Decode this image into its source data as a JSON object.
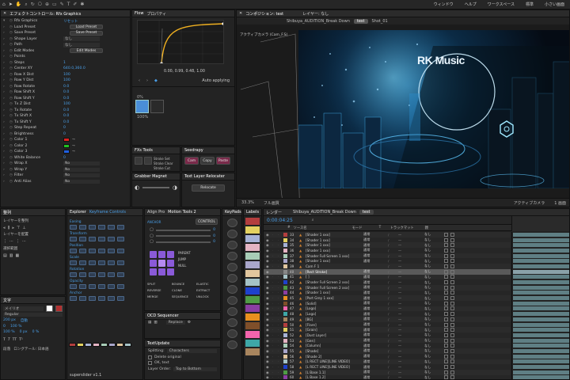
{
  "menubar": {
    "items": [
      "ウィンドウ",
      "ヘルプ",
      "ワークスペース",
      "標準",
      "小さい画面"
    ]
  },
  "left_panel": {
    "title": "エフェクトコントロール: Rfx Graphics",
    "rows": [
      {
        "label": "Rfx Graphics",
        "value": "リセット"
      },
      {
        "label": "Load Preset",
        "value": "Load Preset"
      },
      {
        "label": "Save Preset",
        "value": "Save Preset"
      },
      {
        "label": "Shape Layer",
        "value": "なし"
      },
      {
        "label": "Path",
        "value": "なし"
      },
      {
        "label": "Edit Modes",
        "value": "Edit Modes"
      },
      {
        "label": "Points",
        "value": ""
      },
      {
        "label": "Steps",
        "value": "1"
      },
      {
        "label": "Center XY",
        "value": "640.0,360.0"
      },
      {
        "label": "Row X Dist",
        "value": "100"
      },
      {
        "label": "Row Y Dist",
        "value": "100"
      },
      {
        "label": "Row Rotate",
        "value": "0.0"
      },
      {
        "label": "Row Shift X",
        "value": "0.0"
      },
      {
        "label": "Row Shift Y",
        "value": "0.0"
      },
      {
        "label": "Tx Z Dist",
        "value": "100"
      },
      {
        "label": "Tx Rotate",
        "value": "0.0"
      },
      {
        "label": "Tx Shift X",
        "value": "0.0"
      },
      {
        "label": "Tx Shift Y",
        "value": "0.0"
      },
      {
        "label": "Step Repeat",
        "value": "0"
      },
      {
        "label": "Brightness",
        "value": "0"
      },
      {
        "label": "Color 1",
        "value": ""
      },
      {
        "label": "Color 2",
        "value": ""
      },
      {
        "label": "Color 3",
        "value": ""
      },
      {
        "label": "White Balance",
        "value": "0"
      },
      {
        "label": "Wrap X",
        "value": "No"
      },
      {
        "label": "Wrap Y",
        "value": "No"
      },
      {
        "label": "Filter",
        "value": "No"
      },
      {
        "label": "Anti Alias",
        "value": "No"
      }
    ],
    "colors": [
      "#e02020",
      "#20c020",
      "#2060e0"
    ]
  },
  "flow": {
    "tabs": [
      "Flow",
      "プロパティ"
    ],
    "readout": "0.00, 0.99, 0.48, 1.00",
    "mode": "Auto applying",
    "label_in": "0%",
    "label_out": "100%"
  },
  "comp_view": {
    "tabs": [
      "コンポジション: test",
      "レイヤー: なし"
    ],
    "subtabs": [
      "Shibuya_AUDITION_Break Down",
      "test",
      "Shot_01"
    ],
    "left_label": "アクティブカメラ (Cam_F.S)",
    "watermark": "RK Music",
    "status": [
      "33.3%",
      "フル画質",
      "アクティブカメラ",
      "1 画面"
    ]
  },
  "fx_tools": {
    "title": "FXs Tools",
    "labels": [
      "Stroke Set",
      "Stroke Clear",
      "Stroke Cut"
    ]
  },
  "seedrapy": {
    "title": "Seedrapy",
    "labels": [
      "Cam",
      "Copy",
      "Paste"
    ]
  },
  "grabber": {
    "title": "Grabber Magnet",
    "labels": [
      "tmp",
      "Shot",
      "Anchor"
    ]
  },
  "text_layer": {
    "title": "Text Layer Relocater",
    "button": "Relocate"
  },
  "align_panel": {
    "title": "整列",
    "labels": [
      "レイヤーを整列",
      "レイヤーを配置",
      "選択範囲",
      "配置: 選択範囲"
    ]
  },
  "typo_panel": {
    "labels": [
      "文字",
      "メイリオ",
      "Regular",
      "200 px",
      "自動",
      "0",
      "100 %",
      "100 %",
      "0 px",
      "0 %"
    ],
    "bottom": [
      "段落",
      "ロングテール: 日本語"
    ]
  },
  "explorer": {
    "title": "Keyframe",
    "tabs": [
      "Explorer",
      "Keyframe Controls"
    ],
    "sections": [
      "Easing",
      "Transform",
      "Position",
      "Scale",
      "Rotation",
      "Opacity",
      "Anchor"
    ],
    "footer": "superslider v1.1"
  },
  "motion_tools": {
    "tabs": [
      "Align Pro",
      "Motion Tools 2"
    ],
    "buttons": [
      "ANCHOR",
      "CONTROL",
      "PARENT",
      "JUMP",
      "NULL",
      "SPLIT",
      "BOUNCE",
      "ELASTIC",
      "REVERSE",
      "CLONE",
      "EXTRACT",
      "MERGE",
      "SEQUENCE",
      "UNLOCK"
    ],
    "readout": [
      "0",
      "0",
      "0"
    ]
  },
  "ocd_panel": {
    "title": "OCD Sequencer",
    "value": "Replace"
  },
  "textupdate": {
    "title": "TextUpdate",
    "splitting": "Characters",
    "options": [
      "Delete original",
      "OK, text"
    ],
    "layer_order": "Top to Bottom"
  },
  "keypads": {
    "title": "KeyPads"
  },
  "labels_panel": {
    "title": "Labels",
    "colors": [
      "#b33e3e",
      "#e3d160",
      "#a6b2d6",
      "#e4b4c3",
      "#a8cdb7",
      "#a9a6cb",
      "#e1c69e",
      "#a5c2c6",
      "#1e41cc",
      "#4f9b45",
      "#8b3ea2",
      "#e8901e",
      "#7f4f2a",
      "#f464ad",
      "#3ea7a7",
      "#a8855e"
    ]
  },
  "timeline": {
    "tabs": [
      "レンダー",
      "Shibuya_AUDITION_Break Down",
      "test"
    ],
    "timecode": "0:00:04:25",
    "columns": [
      "#",
      "ソース名",
      "モード",
      "T",
      "トラックマット",
      "親"
    ],
    "layers": [
      {
        "num": "33",
        "name": "[Shader 1 xxx]",
        "mode": "通常",
        "parent": "なし",
        "color": "#b33e3e"
      },
      {
        "num": "34",
        "name": "[Shader 1 xxx]",
        "mode": "通常",
        "parent": "なし",
        "color": "#e3d160"
      },
      {
        "num": "35",
        "name": "[Shader 1 xxx]",
        "mode": "通常",
        "parent": "なし",
        "color": "#a6b2d6"
      },
      {
        "num": "36",
        "name": "[Shader 1 xxx]",
        "mode": "通常",
        "parent": "なし",
        "color": "#e4b4c3"
      },
      {
        "num": "37",
        "name": "[Shader Full Screen 1 xxx]",
        "mode": "通常",
        "parent": "なし",
        "color": "#a8cdb7"
      },
      {
        "num": "38",
        "name": "[Shader 1 xxx]",
        "mode": "通常",
        "parent": "なし",
        "color": "#a9a6cb"
      },
      {
        "num": "39",
        "name": "Cam F 1",
        "mode": "",
        "parent": "なし",
        "color": "#e1c69e"
      },
      {
        "num": "40",
        "name": "[Rect Stroke]",
        "mode": "通常",
        "parent": "なし",
        "color": "#888888"
      },
      {
        "num": "41",
        "name": "[ ]",
        "mode": "通常",
        "parent": "なし",
        "color": "#a5c2c6"
      },
      {
        "num": "42",
        "name": "[Shader Full Screen 2 xxx]",
        "mode": "通常",
        "parent": "なし",
        "color": "#1e41cc"
      },
      {
        "num": "43",
        "name": "[Shader Full Screen 2 xxx]",
        "mode": "通常",
        "parent": "なし",
        "color": "#4f9b45"
      },
      {
        "num": "44",
        "name": "[Shader 1 xxx]",
        "mode": "通常",
        "parent": "なし",
        "color": "#8b3ea2"
      },
      {
        "num": "45",
        "name": "[Part Grey 1 xxx]",
        "mode": "通常",
        "parent": "なし",
        "color": "#e8901e"
      },
      {
        "num": "46",
        "name": "[Solid]",
        "mode": "通常",
        "parent": "なし",
        "color": "#7f4f2a"
      },
      {
        "num": "47",
        "name": "[Logo]",
        "mode": "通常",
        "parent": "なし",
        "color": "#f464ad"
      },
      {
        "num": "48",
        "name": "[Logo]",
        "mode": "通常",
        "parent": "なし",
        "color": "#3ea7a7"
      },
      {
        "num": "49",
        "name": "[BG]",
        "mode": "通常",
        "parent": "なし",
        "color": "#a8855e"
      },
      {
        "num": "50",
        "name": "[Flare]",
        "mode": "通常",
        "parent": "なし",
        "color": "#b33e3e"
      },
      {
        "num": "51",
        "name": "[Grain]",
        "mode": "通常",
        "parent": "なし",
        "color": "#e3d160"
      },
      {
        "num": "52",
        "name": "[Dust Layer]",
        "mode": "通常",
        "parent": "なし",
        "color": "#a6b2d6"
      },
      {
        "num": "53",
        "name": "[Gen]",
        "mode": "通常",
        "parent": "なし",
        "color": "#e4b4c3"
      },
      {
        "num": "54",
        "name": "[Column]",
        "mode": "通常",
        "parent": "なし",
        "color": "#a8cdb7"
      },
      {
        "num": "55",
        "name": "[Shade]",
        "mode": "通常",
        "parent": "なし",
        "color": "#a9a6cb"
      },
      {
        "num": "56",
        "name": "[Shade 2]",
        "mode": "通常",
        "parent": "なし",
        "color": "#e1c69e"
      },
      {
        "num": "57",
        "name": "[L RECT LINE][LINE VIDEO]",
        "mode": "通常",
        "parent": "なし",
        "color": "#a5c2c6"
      },
      {
        "num": "58",
        "name": "[L RECT LINE][LINE VIDEO]",
        "mode": "通常",
        "parent": "なし",
        "color": "#1e41cc"
      },
      {
        "num": "59",
        "name": "[L Base 1.1]",
        "mode": "通常",
        "parent": "なし",
        "color": "#4f9b45"
      },
      {
        "num": "60",
        "name": "[L Base 1.2]",
        "mode": "通常",
        "parent": "なし",
        "color": "#8b3ea2"
      }
    ],
    "selected_index": 7
  },
  "accent": "#4a9fe8"
}
